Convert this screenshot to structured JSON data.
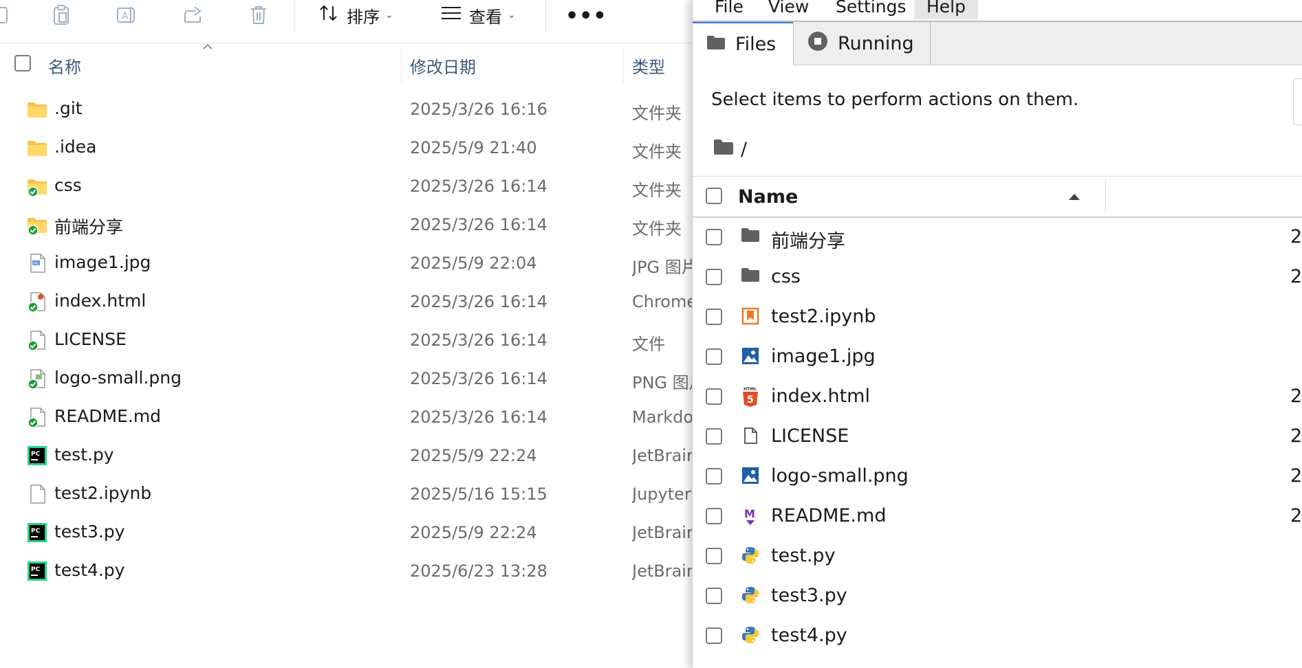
{
  "explorer": {
    "toolbar": {
      "sort_label": "排序",
      "view_label": "查看",
      "more_label": "•••"
    },
    "columns": {
      "name": "名称",
      "modified": "修改日期",
      "type": "类型"
    },
    "rows": [
      {
        "name": ".git",
        "date": "2025/3/26 16:16",
        "type": "文件夹",
        "icon": "folder-icon"
      },
      {
        "name": ".idea",
        "date": "2025/5/9 21:40",
        "type": "文件夹",
        "icon": "folder-icon"
      },
      {
        "name": "css",
        "date": "2025/3/26 16:14",
        "type": "文件夹",
        "icon": "folder-synced-icon"
      },
      {
        "name": "前端分享",
        "date": "2025/3/26 16:14",
        "type": "文件夹",
        "icon": "folder-synced-icon"
      },
      {
        "name": "image1.jpg",
        "date": "2025/5/9 22:04",
        "type": "JPG 图片",
        "icon": "jpg-file-icon"
      },
      {
        "name": "index.html",
        "date": "2025/3/26 16:14",
        "type": "Chrome HTML Document",
        "icon": "html-file-synced-icon"
      },
      {
        "name": "LICENSE",
        "date": "2025/3/26 16:14",
        "type": "文件",
        "icon": "file-synced-icon"
      },
      {
        "name": "logo-small.png",
        "date": "2025/3/26 16:14",
        "type": "PNG 图片",
        "icon": "png-file-synced-icon"
      },
      {
        "name": "README.md",
        "date": "2025/3/26 16:14",
        "type": "Markdown",
        "icon": "md-file-synced-icon"
      },
      {
        "name": "test.py",
        "date": "2025/5/9 22:24",
        "type": "JetBrains",
        "icon": "pycharm-icon"
      },
      {
        "name": "test2.ipynb",
        "date": "2025/5/16 15:15",
        "type": "Jupyter",
        "icon": "blank-file-icon"
      },
      {
        "name": "test3.py",
        "date": "2025/5/9 22:24",
        "type": "JetBrains",
        "icon": "pycharm-icon"
      },
      {
        "name": "test4.py",
        "date": "2025/6/23 13:28",
        "type": "JetBrains",
        "icon": "pycharm-icon"
      }
    ]
  },
  "jupyter": {
    "menu": [
      "File",
      "View",
      "Settings",
      "Help"
    ],
    "tabs": {
      "files": "Files",
      "running": "Running"
    },
    "status": "Select items to perform actions on them.",
    "breadcrumb": "/",
    "header_name": "Name",
    "rows": [
      {
        "name": "前端分享",
        "icon": "folder-icon",
        "modified": "2"
      },
      {
        "name": "css",
        "icon": "folder-icon",
        "modified": "2"
      },
      {
        "name": "test2.ipynb",
        "icon": "notebook-icon",
        "modified": ""
      },
      {
        "name": "image1.jpg",
        "icon": "image-icon",
        "modified": ""
      },
      {
        "name": "index.html",
        "icon": "html5-icon",
        "modified": "2"
      },
      {
        "name": "LICENSE",
        "icon": "file-icon",
        "modified": "2"
      },
      {
        "name": "logo-small.png",
        "icon": "image-icon",
        "modified": "2"
      },
      {
        "name": "README.md",
        "icon": "markdown-icon",
        "modified": "2"
      },
      {
        "name": "test.py",
        "icon": "python-icon",
        "modified": ""
      },
      {
        "name": "test3.py",
        "icon": "python-icon",
        "modified": ""
      },
      {
        "name": "test4.py",
        "icon": "python-icon",
        "modified": ""
      }
    ]
  }
}
